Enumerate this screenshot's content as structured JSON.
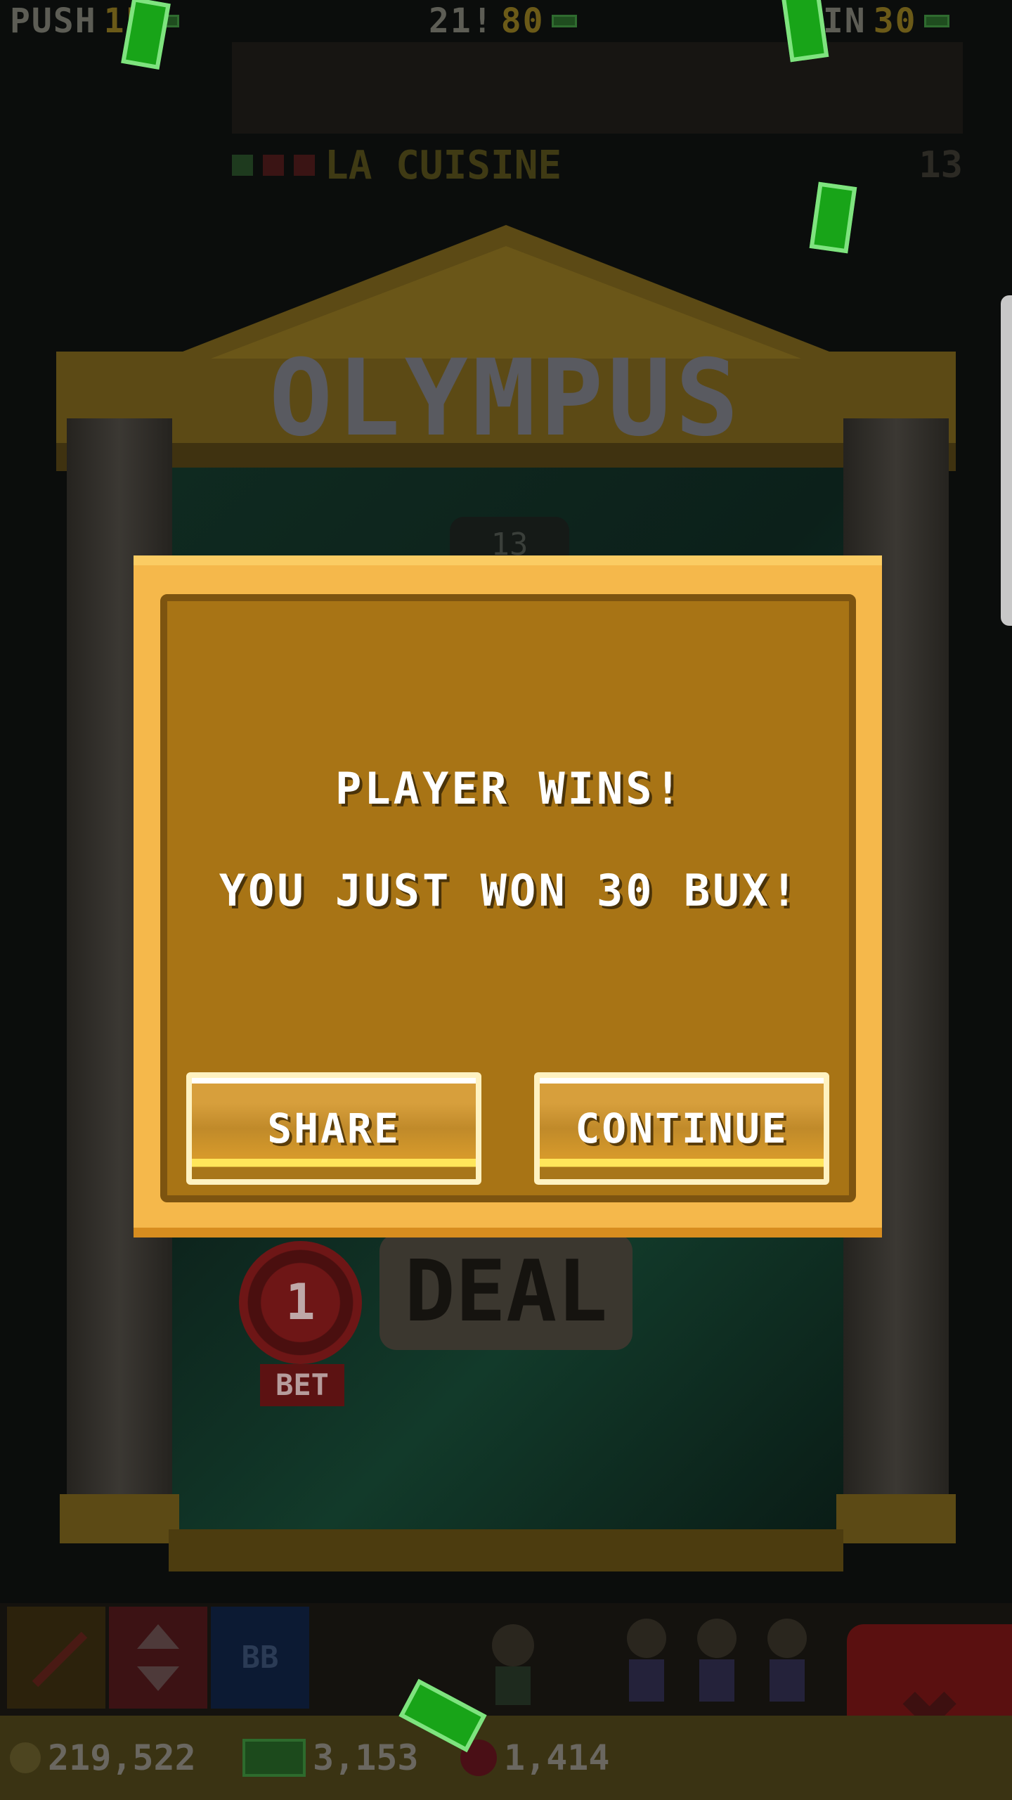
{
  "top_bar": {
    "push_label": "PUSH",
    "push_value": "15",
    "blackjack_label": "21!",
    "blackjack_value": "80",
    "win_label": "WIN",
    "win_value": "30"
  },
  "background": {
    "restaurant_name": "LA CUISINE",
    "floor_number": "13",
    "temple_title": "OLYMPUS",
    "dealer_score": "13"
  },
  "table": {
    "bet_amount": "1",
    "bet_label": "BET",
    "deal_label": "DEAL"
  },
  "shelf": {
    "bb_label": "BB"
  },
  "status": {
    "coins": "219,522",
    "bux": "3,153",
    "gems": "1,414"
  },
  "modal": {
    "title": "PLAYER WINS!",
    "message": "YOU JUST WON 30 BUX!",
    "share_label": "SHARE",
    "continue_label": "CONTINUE"
  },
  "colors": {
    "modal_gold": "#a87415",
    "modal_frame": "#f5b84b",
    "bill_green": "#18a418"
  }
}
